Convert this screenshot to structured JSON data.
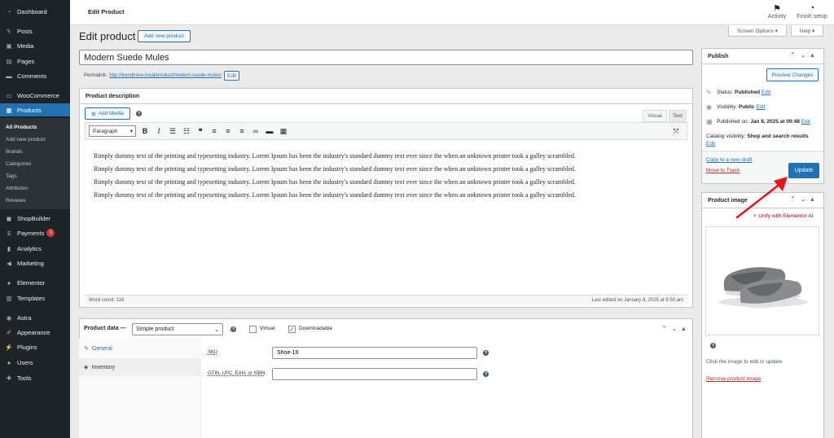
{
  "sidebar": {
    "items": [
      {
        "label": "Dashboard",
        "icon": "dashboard-icon"
      },
      {
        "label": "Posts",
        "icon": "pin-icon"
      },
      {
        "label": "Media",
        "icon": "media-icon"
      },
      {
        "label": "Pages",
        "icon": "pages-icon"
      },
      {
        "label": "Comments",
        "icon": "comments-icon"
      },
      {
        "label": "WooCommerce",
        "icon": "woocommerce-icon"
      },
      {
        "label": "Products",
        "icon": "products-icon"
      },
      {
        "label": "ShopBuilder",
        "icon": "shopbuilder-icon"
      },
      {
        "label": "Payments",
        "icon": "payments-icon",
        "badge": "1"
      },
      {
        "label": "Analytics",
        "icon": "analytics-icon"
      },
      {
        "label": "Marketing",
        "icon": "marketing-icon"
      },
      {
        "label": "Elementor",
        "icon": "elementor-icon"
      },
      {
        "label": "Templates",
        "icon": "templates-icon"
      },
      {
        "label": "Astra",
        "icon": "astra-icon"
      },
      {
        "label": "Appearance",
        "icon": "appearance-icon"
      },
      {
        "label": "Plugins",
        "icon": "plugins-icon"
      },
      {
        "label": "Users",
        "icon": "users-icon"
      },
      {
        "label": "Tools",
        "icon": "tools-icon"
      }
    ],
    "submenu": [
      "All Products",
      "Add new product",
      "Brands",
      "Categories",
      "Tags",
      "Attributes",
      "Reviews"
    ]
  },
  "topbar": {
    "title": "Edit Product",
    "activity": "Activity",
    "finish_setup": "Finish setup"
  },
  "screen_options": "Screen Options ▾",
  "help": "Help ▾",
  "page": {
    "heading": "Edit product",
    "add_new": "Add new product",
    "product_title": "Modern Suede Mules",
    "permalink_label": "Permalink:",
    "permalink_url": "http://trendtrove.local/product/modern-suede-mules/",
    "permalink_edit": "Edit"
  },
  "description": {
    "title": "Product description",
    "add_media": "Add Media",
    "tab_visual": "Visual",
    "tab_text": "Text",
    "format": "Paragraph",
    "lines": [
      "Rimply dummy text of the printing and typesetting industry. Lorem Ipsum has been the industry's standard dummy text ever since the when an unknown printer took a galley scrambled.",
      "Rimply dummy text of the printing and typesetting industry. Lorem Ipsum has been the industry's standard dummy text ever since the when an unknown printer took a galley scrambled.",
      "Rimply dummy text of the printing and typesetting industry. Lorem Ipsum has been the industry's standard dummy text ever since the when an unknown printer took a galley scrambled.",
      "Rimply dummy text of the printing and typesetting industry. Lorem Ipsum has been the industry's standard dummy text ever since the when an unknown printer took a galley scrambled."
    ],
    "word_count": "Word count: 116",
    "last_edited": "Last edited on January 8, 2025 at 9:50 am"
  },
  "product_data": {
    "label": "Product data —",
    "type": "Simple product",
    "virtual": "Virtual",
    "downloadable": "Downloadable",
    "tabs": [
      "General",
      "Inventory"
    ],
    "sku_label": "SKU",
    "sku_value": "Shoe-19",
    "gtin_label": "GTIN, UPC, EAN, or ISBN",
    "gtin_value": ""
  },
  "publish": {
    "title": "Publish",
    "preview": "Preview Changes",
    "status_label": "Status:",
    "status_value": "Published",
    "visibility_label": "Visibility:",
    "visibility_value": "Public",
    "published_label": "Published on:",
    "published_value": "Jan 8, 2025 at 09:48",
    "edit": "Edit",
    "catalog_label": "Catalog visibility:",
    "catalog_value": "Shop and search results",
    "copy_draft": "Copy to a new draft",
    "trash": "Move to Trash",
    "update": "Update"
  },
  "product_image": {
    "title": "Product image",
    "unify": "Unify with Elementor AI",
    "hint": "Click the image to edit or update",
    "remove": "Remove product image"
  },
  "colors": {
    "accent": "#2271b1",
    "sidebar": "#1d2327",
    "trash": "#b32d2e",
    "arrow": "#e2151b",
    "elementor": "#92003b"
  }
}
